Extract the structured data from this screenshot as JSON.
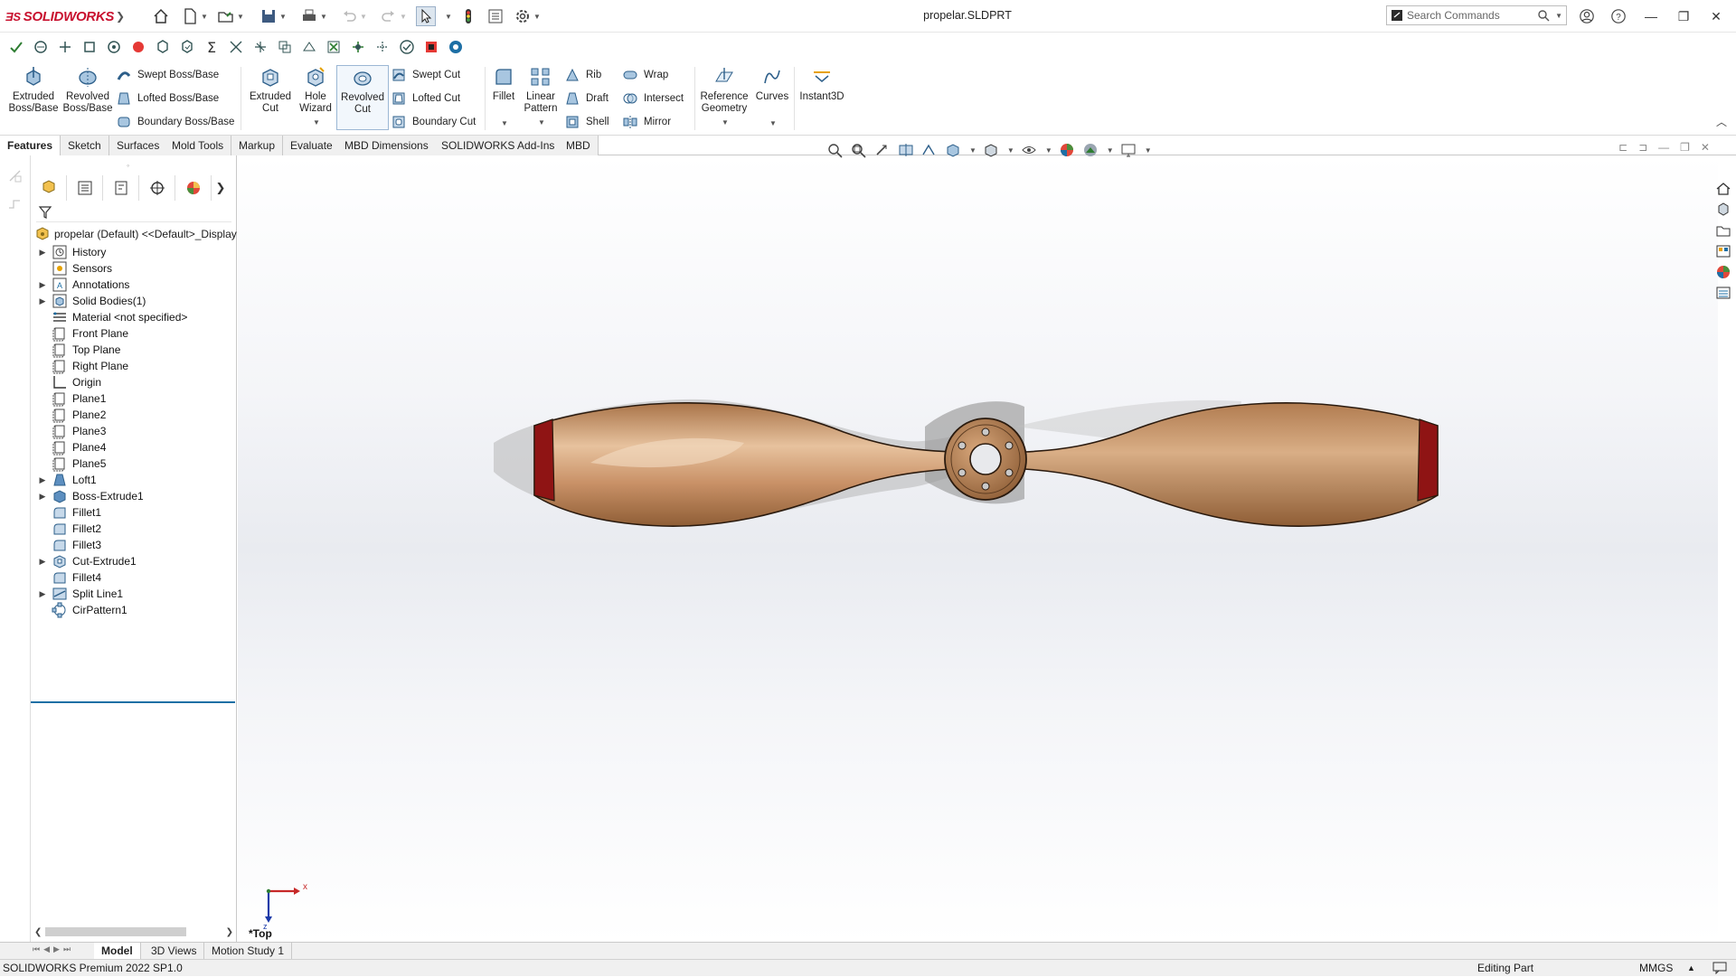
{
  "app": {
    "brand": "SOLIDWORKS",
    "doc_title": "propelar.SLDPRT"
  },
  "search": {
    "placeholder": "Search Commands"
  },
  "ribbon": {
    "extruded_boss": "Extruded Boss/Base",
    "revolved_boss": "Revolved Boss/Base",
    "swept_boss": "Swept Boss/Base",
    "lofted_boss": "Lofted Boss/Base",
    "boundary_boss": "Boundary Boss/Base",
    "extruded_cut": "Extruded Cut",
    "hole_wizard": "Hole Wizard",
    "revolved_cut": "Revolved Cut",
    "swept_cut": "Swept Cut",
    "lofted_cut": "Lofted Cut",
    "boundary_cut": "Boundary Cut",
    "fillet": "Fillet",
    "linear_pattern": "Linear Pattern",
    "rib": "Rib",
    "draft": "Draft",
    "shell": "Shell",
    "wrap": "Wrap",
    "intersect": "Intersect",
    "mirror": "Mirror",
    "reference_geometry": "Reference Geometry",
    "curves": "Curves",
    "instant3d": "Instant3D"
  },
  "tabs": [
    "Features",
    "Sketch",
    "Surfaces",
    "Mold Tools",
    "Markup",
    "Evaluate",
    "MBD Dimensions",
    "SOLIDWORKS Add-Ins",
    "MBD"
  ],
  "tree": {
    "root": "propelar (Default) <<Default>_Display",
    "items": [
      {
        "label": "History",
        "expand": true
      },
      {
        "label": "Sensors",
        "expand": false
      },
      {
        "label": "Annotations",
        "expand": true
      },
      {
        "label": "Solid Bodies(1)",
        "expand": true
      },
      {
        "label": "Material <not specified>",
        "expand": false
      },
      {
        "label": "Front Plane",
        "expand": false
      },
      {
        "label": "Top Plane",
        "expand": false
      },
      {
        "label": "Right Plane",
        "expand": false
      },
      {
        "label": "Origin",
        "expand": false
      },
      {
        "label": "Plane1",
        "expand": false
      },
      {
        "label": "Plane2",
        "expand": false
      },
      {
        "label": "Plane3",
        "expand": false
      },
      {
        "label": "Plane4",
        "expand": false
      },
      {
        "label": "Plane5",
        "expand": false
      },
      {
        "label": "Loft1",
        "expand": true
      },
      {
        "label": "Boss-Extrude1",
        "expand": true
      },
      {
        "label": "Fillet1",
        "expand": false
      },
      {
        "label": "Fillet2",
        "expand": false
      },
      {
        "label": "Fillet3",
        "expand": false
      },
      {
        "label": "Cut-Extrude1",
        "expand": true
      },
      {
        "label": "Fillet4",
        "expand": false
      },
      {
        "label": "Split Line1",
        "expand": true
      },
      {
        "label": "CirPattern1",
        "expand": false
      }
    ]
  },
  "viewport": {
    "view_label": "*Top",
    "triad_x": "x",
    "triad_z": "z"
  },
  "bottom_tabs": [
    "Model",
    "3D Views",
    "Motion Study 1"
  ],
  "status": {
    "version": "SOLIDWORKS Premium 2022 SP1.0",
    "mode": "Editing Part",
    "units": "MMGS"
  },
  "colors": {
    "brand_red": "#c8102e",
    "wood": "#c89468",
    "tip_red": "#9e1616",
    "accent": "#1d6fa5"
  }
}
